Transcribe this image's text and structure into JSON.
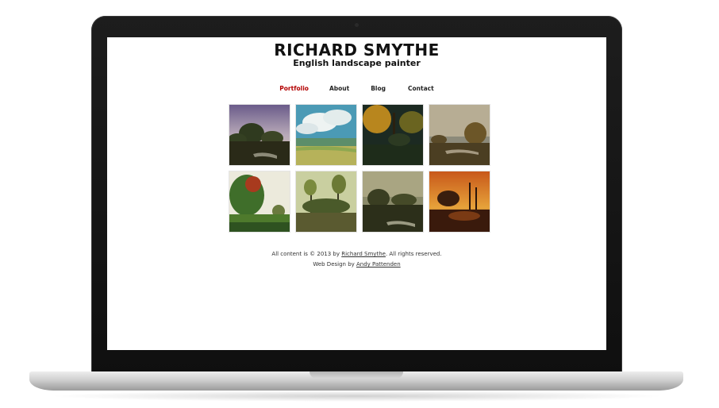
{
  "site": {
    "title": "RICHARD SMYTHE",
    "subtitle": "English landscape painter"
  },
  "nav": {
    "items": [
      {
        "label": "Portfolio",
        "active": true
      },
      {
        "label": "About",
        "active": false
      },
      {
        "label": "Blog",
        "active": false
      },
      {
        "label": "Contact",
        "active": false
      }
    ],
    "active_color": "#b30000"
  },
  "gallery": {
    "thumbnails": [
      {
        "icon": "landscape-painting-thumbnail"
      },
      {
        "icon": "landscape-painting-thumbnail"
      },
      {
        "icon": "landscape-painting-thumbnail"
      },
      {
        "icon": "landscape-painting-thumbnail"
      },
      {
        "icon": "landscape-painting-thumbnail"
      },
      {
        "icon": "landscape-painting-thumbnail"
      },
      {
        "icon": "landscape-painting-thumbnail"
      },
      {
        "icon": "landscape-painting-thumbnail"
      }
    ]
  },
  "footer": {
    "copyright_prefix": "All content is © 2013 by ",
    "copyright_link": "Richard Smythe",
    "copyright_suffix": ". All rights reserved.",
    "design_prefix": "Web Design by ",
    "design_link": "Andy Pattenden"
  }
}
